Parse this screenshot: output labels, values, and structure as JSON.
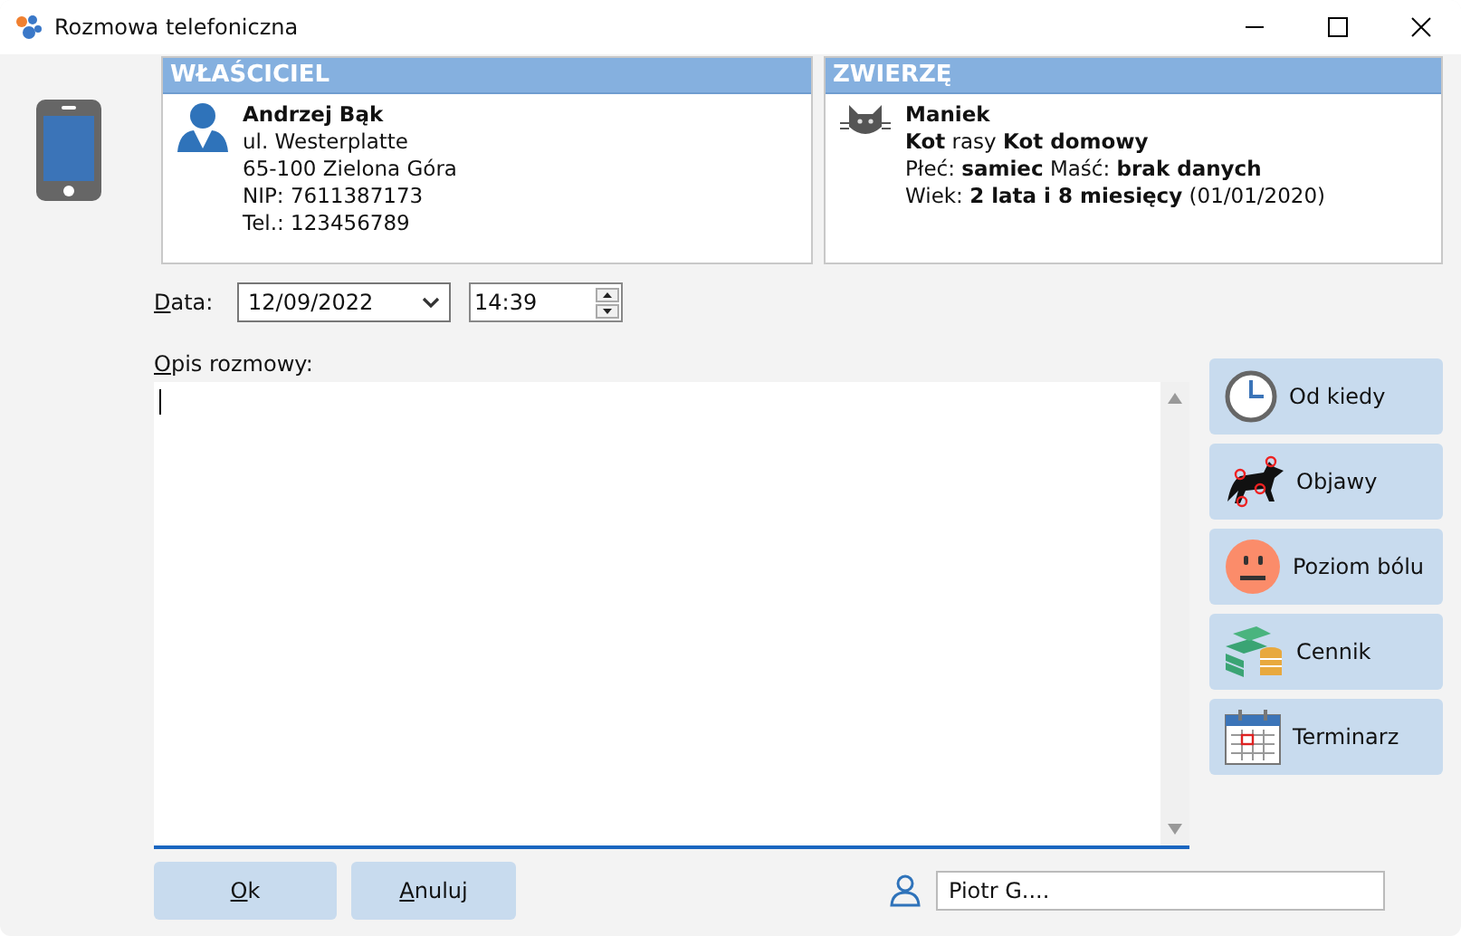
{
  "window": {
    "title": "Rozmowa telefoniczna"
  },
  "owner": {
    "header": "WŁAŚCICIEL",
    "name": "Andrzej Bąk",
    "lines": [
      "ul. Westerplatte",
      "65-100  Zielona Góra",
      "NIP: 7611387173",
      "Tel.: 123456789"
    ]
  },
  "animal": {
    "header": "ZWIERZĘ",
    "name": "Maniek",
    "lines": [
      "**Kot** rasy **Kot domowy**",
      "Płeć: **samiec**  Maść: **brak danych**",
      "Wiek: **2 lata i 8 miesięcy** (01/01/2020)"
    ]
  },
  "date": {
    "label": "Data:",
    "value": "12/09/2022",
    "time": "14:39"
  },
  "description": {
    "label": "Opis rozmowy:"
  },
  "side_buttons": [
    {
      "kind": "clock",
      "label": "Od kiedy"
    },
    {
      "kind": "dog",
      "label": "Objawy"
    },
    {
      "kind": "face",
      "label": "Poziom bólu"
    },
    {
      "kind": "money",
      "label": "Cennik"
    },
    {
      "kind": "calendar",
      "label": "Terminarz"
    }
  ],
  "buttons": [
    "Ok",
    "Anuluj"
  ],
  "user": {
    "value": "Piotr G...."
  }
}
